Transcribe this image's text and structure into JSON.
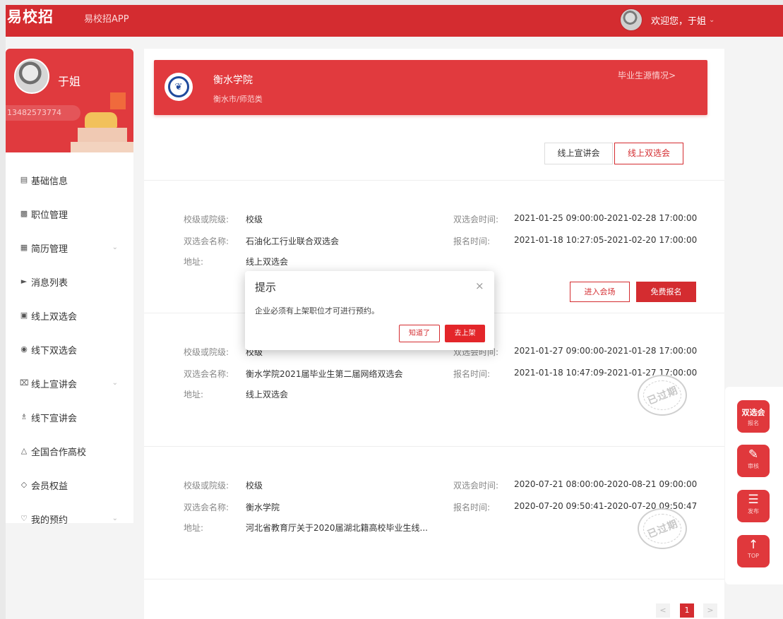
{
  "header": {
    "logo": "易校招",
    "app_link": "易校招APP",
    "welcome": "欢迎您，于姐"
  },
  "sidebar": {
    "profile": {
      "name": "于姐",
      "phone": "13482573774"
    },
    "items": [
      {
        "label": "基础信息",
        "icon": "document-icon"
      },
      {
        "label": "职位管理",
        "icon": "briefcase-icon"
      },
      {
        "label": "简历管理",
        "icon": "resume-icon",
        "expandable": true
      },
      {
        "label": "消息列表",
        "icon": "speaker-icon"
      },
      {
        "label": "线上双选会",
        "icon": "screen-icon"
      },
      {
        "label": "线下双选会",
        "icon": "location-icon"
      },
      {
        "label": "线上宣讲会",
        "icon": "microphone-icon",
        "expandable": true
      },
      {
        "label": "线下宣讲会",
        "icon": "people-icon"
      },
      {
        "label": "全国合作高校",
        "icon": "graduation-cap-icon"
      },
      {
        "label": "会员权益",
        "icon": "diamond-icon"
      },
      {
        "label": "我的预约",
        "icon": "heart-icon",
        "expandable": true
      }
    ]
  },
  "school": {
    "name": "衡水学院",
    "sub": "衡水市/师范类",
    "grad_link": "毕业生源情况>"
  },
  "tabs": [
    {
      "label": "线上宣讲会",
      "active": false
    },
    {
      "label": "线上双选会",
      "active": true
    }
  ],
  "labels": {
    "level": "校级或院级:",
    "fair_time": "双选会时间:",
    "fair_name": "双选会名称:",
    "signup_time": "报名时间:",
    "address": "地址:"
  },
  "fairs": [
    {
      "level": "校级",
      "fair_time": "2021-01-25 09:00:00-2021-02-28 17:00:00",
      "name": "石油化工行业联合双选会",
      "signup_time": "2021-01-18 10:27:05-2021-02-20 17:00:00",
      "address": "线上双选会",
      "enter_label": "进入会场",
      "register_label": "免费报名"
    },
    {
      "level": "校级",
      "fair_time": "2021-01-27 09:00:00-2021-01-28 17:00:00",
      "name": "衡水学院2021届毕业生第二届网络双选会",
      "signup_time": "2021-01-18 10:47:09-2021-01-27 17:00:00",
      "address": "线上双选会",
      "stamp": "已过期"
    },
    {
      "level": "校级",
      "fair_time": "2020-07-21 08:00:00-2020-08-21 09:00:00",
      "name": "衡水学院",
      "signup_time": "2020-07-20 09:50:41-2020-07-20 09:50:47",
      "address": "河北省教育厅关于2020届湖北籍高校毕业生线...",
      "stamp": "已过期"
    }
  ],
  "pagination": {
    "prev": "<",
    "current": "1",
    "next": ">"
  },
  "float_bar": [
    {
      "main": "双选会",
      "sub": "报名"
    },
    {
      "main": "",
      "sub": "审核",
      "icon": "audit-icon"
    },
    {
      "main": "",
      "sub": "发布",
      "icon": "edit-icon"
    },
    {
      "main": "",
      "sub": "TOP",
      "icon": "arrow-up-icon"
    }
  ],
  "modal": {
    "title": "提示",
    "message": "企业必须有上架职位才可进行预约。",
    "ok_label": "知道了",
    "shelf_label": "去上架"
  },
  "colors": {
    "brand": "#d42c30",
    "banner": "#e13a3e"
  }
}
